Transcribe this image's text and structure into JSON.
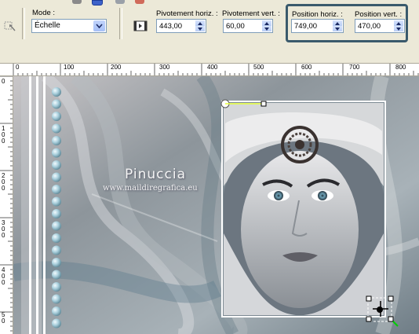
{
  "toolbar": {
    "mode_label": "Mode :",
    "mode_value": "Échelle",
    "rot_h_label": "Pivotement horiz. :",
    "rot_h_value": "443,00",
    "rot_v_label": "Pivotement vert. :",
    "rot_v_value": "60,00",
    "pos_h_label": "Position horiz. :",
    "pos_h_value": "749,00",
    "pos_v_label": "Position vert. :",
    "pos_v_value": "470,00"
  },
  "ruler": {
    "top_ticks": [
      "0",
      "100",
      "200",
      "300",
      "400",
      "500",
      "600",
      "700",
      "800"
    ],
    "left_ticks": [
      "0",
      "1\n0\n0",
      "2\n0\n0",
      "3\n0\n0",
      "4\n0\n0",
      "5\n0"
    ]
  },
  "canvas": {
    "watermark_name": "Pinuccia",
    "watermark_url": "www.maildiregrafica.eu"
  },
  "colors": {
    "highlight_border": "#3a5a6c",
    "canvas_base": "#8f979d",
    "frame": "#ffffff"
  }
}
